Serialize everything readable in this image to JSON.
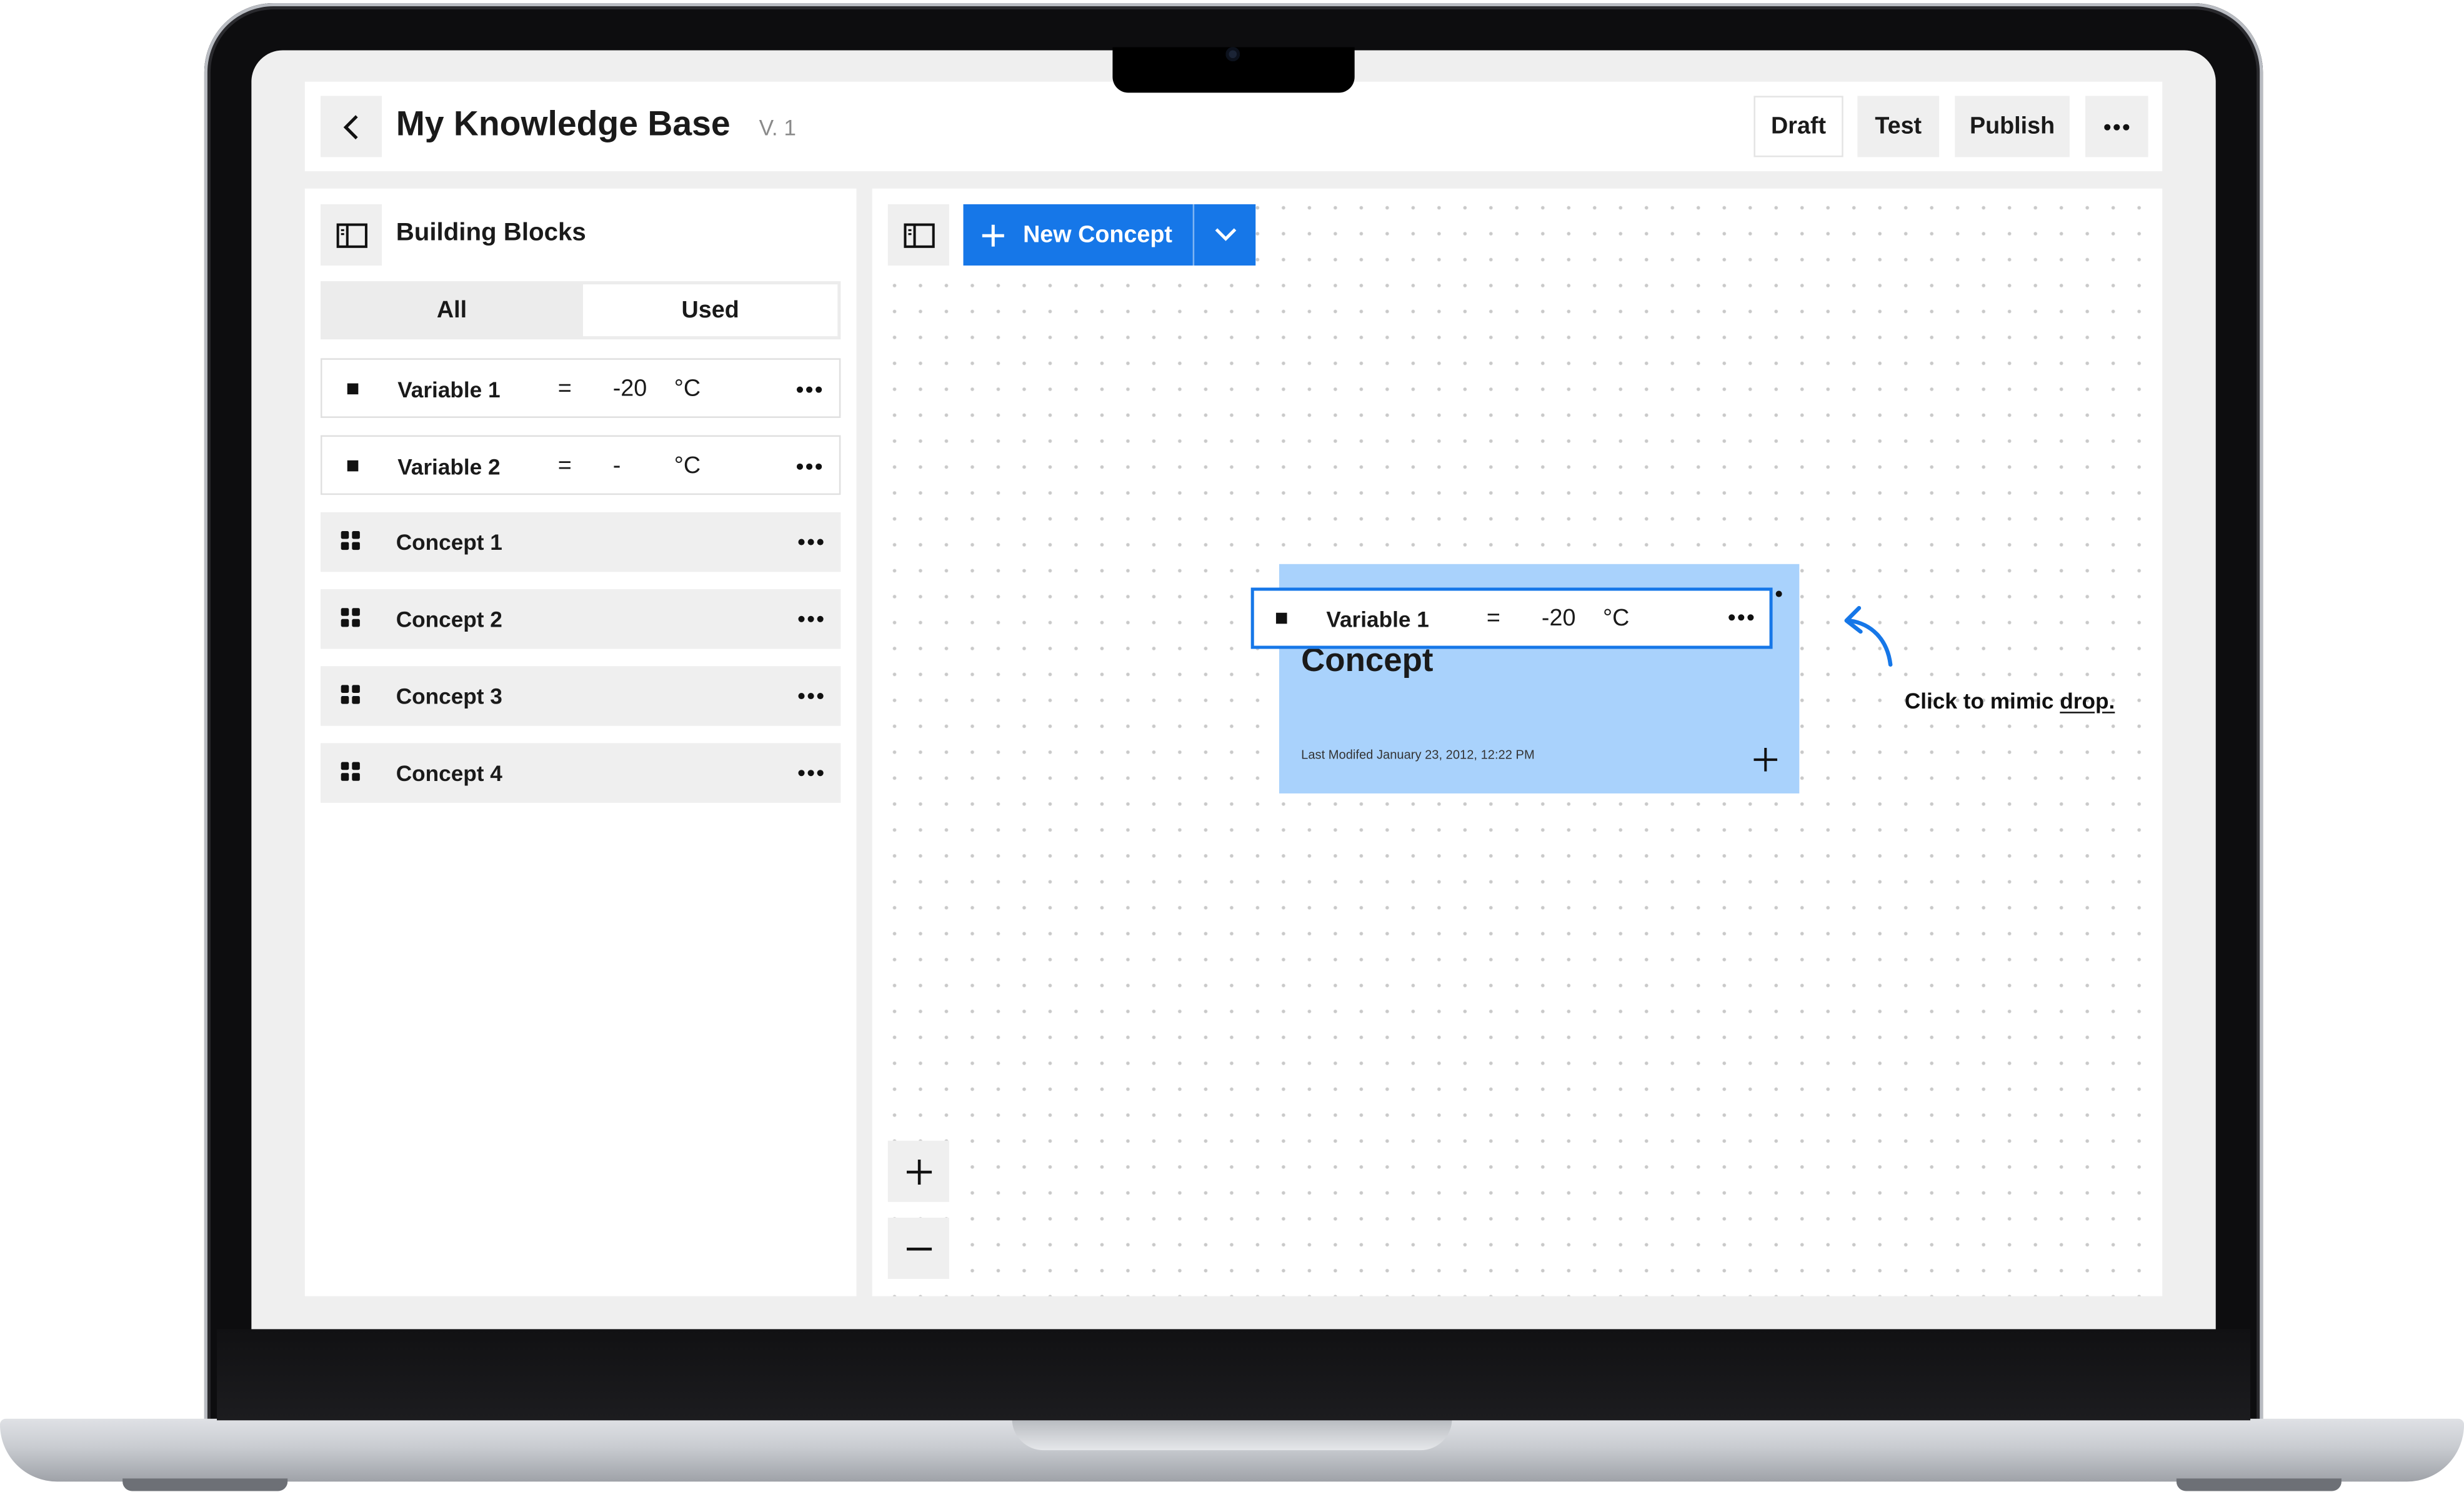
{
  "header": {
    "title": "My Knowledge Base",
    "version": "V. 1",
    "buttons": {
      "draft": "Draft",
      "test": "Test",
      "publish": "Publish"
    }
  },
  "sidebar": {
    "title": "Building Blocks",
    "tabs": {
      "all": "All",
      "used": "Used",
      "selected": "Used"
    },
    "variables": [
      {
        "name": "Variable 1",
        "operator": "=",
        "value": "-20",
        "unit": "°C"
      },
      {
        "name": "Variable 2",
        "operator": "=",
        "value": "-",
        "unit": "°C"
      }
    ],
    "concepts": [
      {
        "name": "Concept 1"
      },
      {
        "name": "Concept 2"
      },
      {
        "name": "Concept 3"
      },
      {
        "name": "Concept 4"
      }
    ]
  },
  "toolbar": {
    "new_concept_label": "New Concept"
  },
  "canvas": {
    "card": {
      "title": "Concept",
      "last_modified": "Last Modifed January 23, 2012, 12:22 PM"
    },
    "dragged_variable": {
      "name": "Variable 1",
      "operator": "=",
      "value": "-20",
      "unit": "°C"
    },
    "hint_text": "Click to mimic ",
    "hint_link": "drop."
  },
  "colors": {
    "accent": "#1677e8",
    "card": "#a9d2fc",
    "panel": "#efefef"
  }
}
